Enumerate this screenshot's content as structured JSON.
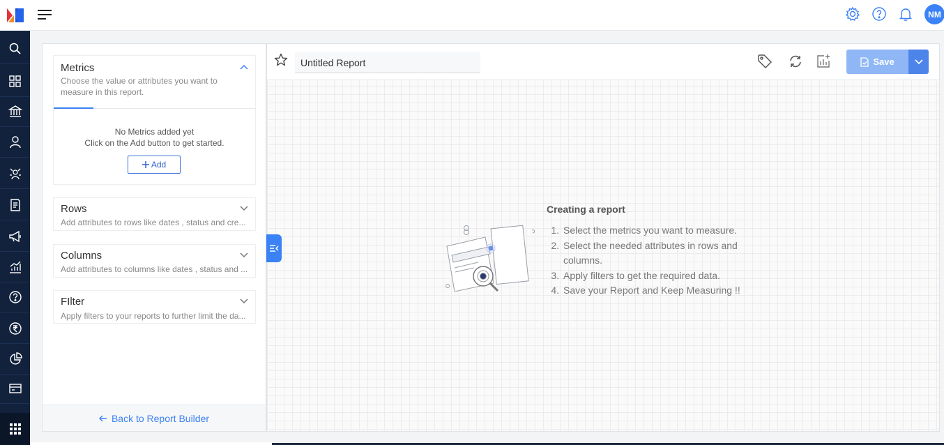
{
  "nav": {
    "items": [
      "search-icon",
      "dashboard-icon",
      "bank-icon",
      "user-icon",
      "network-icon",
      "document-icon",
      "megaphone-icon",
      "analytics-icon",
      "help-icon",
      "rupee-icon",
      "pie-chart-icon",
      "card-icon"
    ],
    "bottom": "apps-grid-icon",
    "colors": {
      "bg": "#12223d",
      "accent": "#3b82f6"
    }
  },
  "topbar": {
    "avatar_initials": "NM"
  },
  "panel": {
    "metrics": {
      "title": "Metrics",
      "description_line1": "Choose the value or attributes you want to",
      "description_line2": "measure in this report.",
      "empty_line1": "No Metrics added yet",
      "empty_line2": "Click on the Add button to get started.",
      "add_label": "Add"
    },
    "rows": {
      "title": "Rows",
      "description": "Add attributes to rows like dates , status and cre..."
    },
    "columns": {
      "title": "Columns",
      "description": "Add attributes to columns like dates , status and ..."
    },
    "filter": {
      "title": "FIlter",
      "description": "Apply filters to your reports to further limit the da..."
    },
    "footer_label": "Back to Report Builder"
  },
  "report": {
    "title_value": "Untitled Report",
    "save_label": "Save"
  },
  "empty_state": {
    "title": "Creating a report",
    "steps": [
      {
        "num": "1.",
        "text": "Select the metrics you want to measure."
      },
      {
        "num": "2.",
        "text": "Select the needed attributes in rows and columns."
      },
      {
        "num": "3.",
        "text": "Apply filters to get the required data."
      },
      {
        "num": "4.",
        "text": "Save your Report and Keep Measuring !!"
      }
    ]
  }
}
